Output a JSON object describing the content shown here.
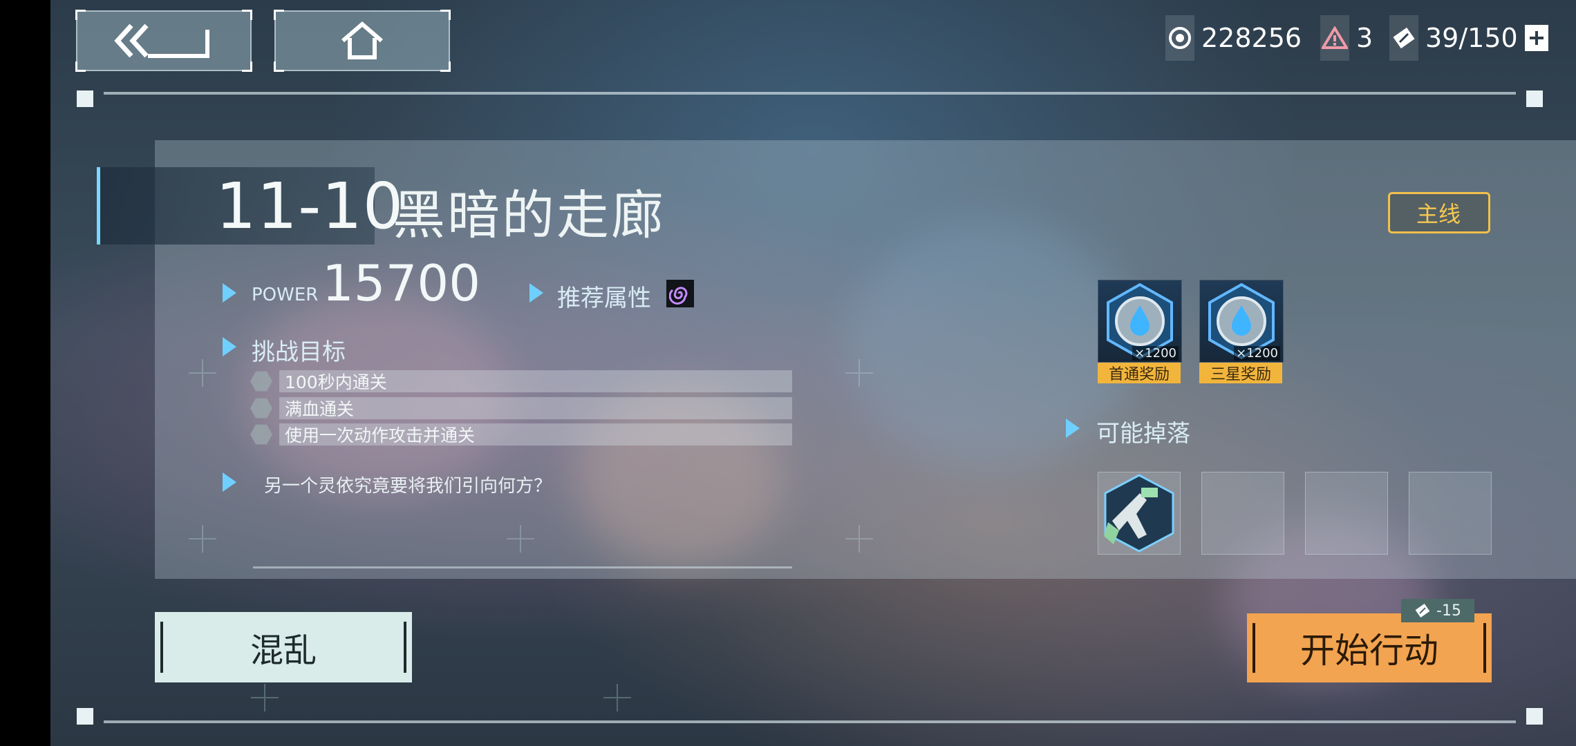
{
  "nav": {
    "back_icon": "double-chevron-back-icon",
    "home_icon": "home-icon"
  },
  "resources": {
    "currency": {
      "icon": "orb-icon",
      "value": "228256"
    },
    "alert": {
      "icon": "warning-triangle-icon",
      "value": "3"
    },
    "stamina": {
      "icon": "ticket-icon",
      "value": "39/150",
      "add_icon": "plus-icon"
    }
  },
  "stage": {
    "id": "11-10",
    "name": "黑暗的走廊",
    "power_label": "POWER",
    "power_value": "15700",
    "recommended_label": "推荐属性",
    "recommended_icon": "spiral-attribute-icon",
    "objectives_label": "挑战目标",
    "objectives": [
      "100秒内通关",
      "满血通关",
      "使用一次动作攻击并通关"
    ],
    "description": "另一个灵依究竟要将我们引向何方？",
    "tag": "主线"
  },
  "rewards": [
    {
      "icon": "water-crystal-icon",
      "qty": "×1200",
      "label": "首通奖励"
    },
    {
      "icon": "water-crystal-icon",
      "qty": "×1200",
      "label": "三星奖励"
    }
  ],
  "drops": {
    "label": "可能掉落",
    "items": [
      {
        "icon": "gun-weapon-icon"
      },
      {
        "icon": ""
      },
      {
        "icon": ""
      },
      {
        "icon": ""
      }
    ]
  },
  "actions": {
    "chaos_label": "混乱",
    "start_label": "开始行动",
    "start_cost": "-15"
  },
  "colors": {
    "accent_blue": "#6fd0ff",
    "start_orange": "#f3a450",
    "reward_gold": "#f2b53c",
    "tag_gold": "#f2c04a"
  }
}
